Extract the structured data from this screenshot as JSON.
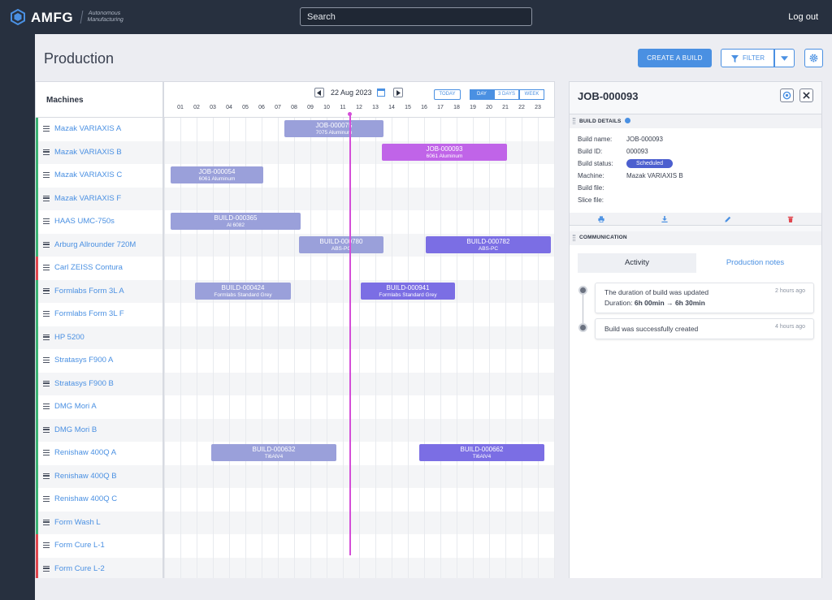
{
  "app": {
    "logo": "AMFG",
    "logo_sub_1": "Autonomous",
    "logo_sub_2": "Manufacturing",
    "logout": "Log out"
  },
  "search": {
    "placeholder": "Search"
  },
  "page": {
    "title": "Production",
    "create_label": "CREATE A BUILD",
    "filter_label": "FILTER"
  },
  "schedule": {
    "machines_header": "Machines",
    "date": "22 Aug 2023",
    "today_label": "TODAY",
    "ranges": [
      "DAY",
      "3 DAYS",
      "WEEK"
    ],
    "active_range": "DAY",
    "current_time_hour": 11.4,
    "hours": [
      "01",
      "02",
      "03",
      "04",
      "05",
      "06",
      "07",
      "08",
      "09",
      "10",
      "11",
      "12",
      "13",
      "14",
      "15",
      "16",
      "17",
      "18",
      "19",
      "20",
      "21",
      "22",
      "23"
    ],
    "machines": [
      {
        "name": "Mazak VARIAXIS A",
        "status": "green"
      },
      {
        "name": "Mazak VARIAXIS B",
        "status": "green"
      },
      {
        "name": "Mazak VARIAXIS C",
        "status": "green"
      },
      {
        "name": "Mazak VARIAXIS F",
        "status": "green"
      },
      {
        "name": "HAAS UMC-750s",
        "status": "green"
      },
      {
        "name": "Arburg Allrounder 720M",
        "status": "green"
      },
      {
        "name": "Carl ZEISS Contura",
        "status": "red"
      },
      {
        "name": "Formlabs Form 3L A",
        "status": "green"
      },
      {
        "name": "Formlabs Form 3L F",
        "status": "green"
      },
      {
        "name": "HP 5200",
        "status": "green"
      },
      {
        "name": "Stratasys F900 A",
        "status": "green"
      },
      {
        "name": "Stratasys F900 B",
        "status": "green"
      },
      {
        "name": "DMG Mori A",
        "status": "green"
      },
      {
        "name": "DMG Mori B",
        "status": "green"
      },
      {
        "name": "Renishaw 400Q A",
        "status": "green"
      },
      {
        "name": "Renishaw 400Q B",
        "status": "green"
      },
      {
        "name": "Renishaw 400Q C",
        "status": "green"
      },
      {
        "name": "Form Wash L",
        "status": "green"
      },
      {
        "name": "Form Cure L-1",
        "status": "red"
      },
      {
        "name": "Form Cure L-2",
        "status": "red"
      }
    ],
    "jobs": [
      {
        "id": "JOB-000075",
        "material": "7075 Aluminum",
        "row": 0,
        "start": 7.4,
        "end": 13.5,
        "style": "light"
      },
      {
        "id": "JOB-000093",
        "material": "6061 Aluminum",
        "row": 1,
        "start": 13.4,
        "end": 21.1,
        "style": "sel"
      },
      {
        "id": "JOB-000054",
        "material": "6061 Aluminum",
        "row": 2,
        "start": 0.4,
        "end": 6.1,
        "style": "light"
      },
      {
        "id": "BUILD-000365",
        "material": "Al 6082",
        "row": 4,
        "start": 0.4,
        "end": 8.4,
        "style": "light"
      },
      {
        "id": "BUILD-000780",
        "material": "ABS-PC",
        "row": 5,
        "start": 8.3,
        "end": 13.5,
        "style": "light"
      },
      {
        "id": "BUILD-000782",
        "material": "ABS-PC",
        "row": 5,
        "start": 16.1,
        "end": 23.8,
        "style": "dark"
      },
      {
        "id": "BUILD-000424",
        "material": "Formlabs Standard Grey",
        "row": 7,
        "start": 1.9,
        "end": 7.8,
        "style": "light"
      },
      {
        "id": "BUILD-000941",
        "material": "Formlabs Standard Grey",
        "row": 7,
        "start": 12.1,
        "end": 17.9,
        "style": "dark"
      },
      {
        "id": "BUILD-000632",
        "material": "Ti6AlV4",
        "row": 14,
        "start": 2.9,
        "end": 10.6,
        "style": "light"
      },
      {
        "id": "BUILD-000662",
        "material": "Ti6AlV4",
        "row": 14,
        "start": 15.7,
        "end": 23.4,
        "style": "dark"
      }
    ]
  },
  "detail": {
    "title": "JOB-000093",
    "section_build": "BUILD DETAILS",
    "fields": [
      {
        "label": "Build name:",
        "value": "JOB-000093"
      },
      {
        "label": "Build ID:",
        "value": "000093"
      },
      {
        "label": "Build status:",
        "value": "Scheduled"
      },
      {
        "label": "Machine:",
        "value": "Mazak VARIAXIS B"
      },
      {
        "label": "Build file:",
        "value": ""
      },
      {
        "label": "Slice file:",
        "value": ""
      }
    ],
    "section_comm": "COMMUNICATION",
    "tabs": [
      "Activity",
      "Production notes"
    ],
    "activity": [
      {
        "text": "The duration of build was updated",
        "sub_prefix": "Duration: ",
        "sub_from": "6h 00min",
        "sub_arrow": " → ",
        "sub_to": "6h 30min",
        "time": "2 hours ago"
      },
      {
        "text": "Build was successfully created",
        "time": "4 hours ago"
      }
    ]
  },
  "colors": {
    "accent": "#4a90e2",
    "nav": "#27303f",
    "ok": "#3bb273",
    "error": "#e0464e",
    "now": "#d44ed8"
  }
}
